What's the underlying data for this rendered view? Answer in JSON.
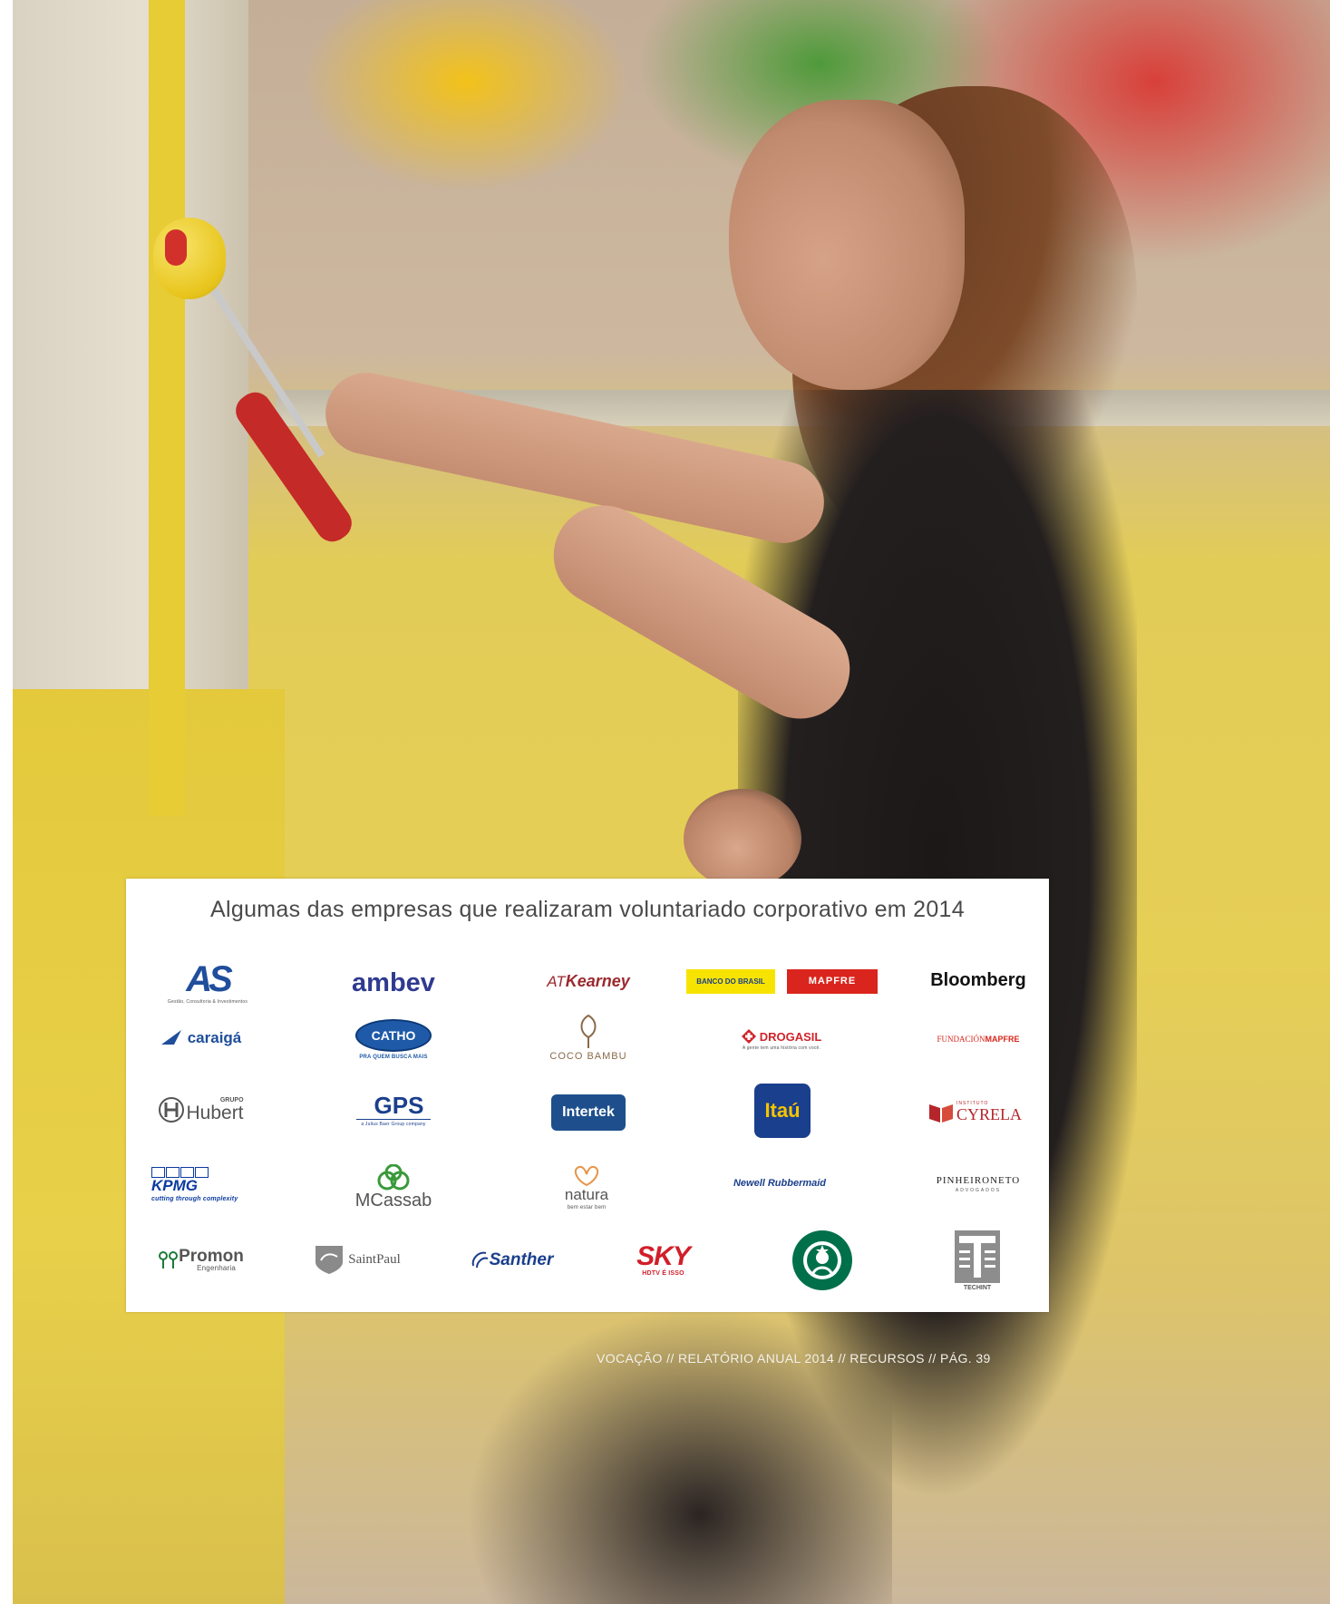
{
  "panel": {
    "title": "Algumas das empresas que realizaram voluntariado corporativo em 2014"
  },
  "logos": {
    "as": {
      "mark": "AS",
      "sub": "Gestão, Consultoria & Investimentos"
    },
    "ambev": {
      "text": "ambev"
    },
    "atkearney": {
      "at": "AT",
      "kearney": "Kearney"
    },
    "bb": {
      "text": "BANCO DO BRASIL"
    },
    "mapfre": {
      "text": "MAPFRE"
    },
    "bloomberg": {
      "text": "Bloomberg"
    },
    "caraiga": {
      "text": "caraigá"
    },
    "catho": {
      "text": "CATHO",
      "sub": "PRA QUEM BUSCA MAIS"
    },
    "coco": {
      "text": "COCO BAMBU"
    },
    "drogasil": {
      "text": "DROGASIL",
      "sub": "A gente tem uma história com você."
    },
    "fundacion": {
      "a": "FUNDACIÓN",
      "b": "MAPFRE"
    },
    "hubert": {
      "grupo": "GRUPO",
      "text": "Hubert"
    },
    "gps": {
      "text": "GPS",
      "sub": "a Julius Baer Group company"
    },
    "intertek": {
      "text": "Intertek"
    },
    "itau": {
      "text": "Itaú"
    },
    "cyrela": {
      "instituto": "INSTITUTO",
      "text": "CYRELA"
    },
    "kpmg": {
      "text": "KPMG",
      "sub": "cutting through complexity"
    },
    "mcassab": {
      "text": "MCassab"
    },
    "natura": {
      "text": "natura",
      "sub": "bem estar bem"
    },
    "newell": {
      "text": "Newell Rubbermaid"
    },
    "pinheiro": {
      "text": "PINHEIRONETO",
      "sub": "ADVOGADOS"
    },
    "promon": {
      "text": "Promon",
      "sub": "Engenharia"
    },
    "saintpaul": {
      "text": "SaintPaul"
    },
    "santher": {
      "text": "Santher"
    },
    "sky": {
      "text": "SKY",
      "sub": "HDTV É ISSO"
    },
    "starbucks": {
      "text": "STARBUCKS"
    },
    "techint": {
      "text": "TECHINT"
    }
  },
  "footer": {
    "text": "VOCAÇÃO  //  RELATÓRIO ANUAL  2014  //  RECURSOS  //  PÁG. 39"
  },
  "colors": {
    "as_blue": "#1f4e9c",
    "ambev_blue": "#2f3a8f",
    "kearney_red": "#9a2a2e",
    "bb_yellow": "#f7e300",
    "mapfre_red": "#d9251d",
    "catho_blue": "#1e5aa8",
    "drogasil_red": "#d0242b",
    "intertek_blue": "#1e4f8c",
    "itau_blue": "#1a3f8c",
    "itau_yellow": "#f5c400",
    "cyrela_red": "#b5262b",
    "kpmg_blue": "#0b3aa0",
    "mcassab_green": "#3a9a3a",
    "promon_green": "#1c7a3a",
    "sky_red": "#d11f2a",
    "starbucks_green": "#00704a"
  }
}
